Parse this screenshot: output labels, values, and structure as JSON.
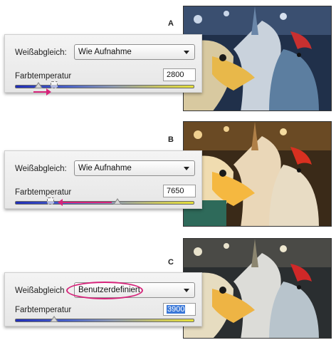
{
  "panels": [
    {
      "letter": "A",
      "wb_label": "Weißabgleich:",
      "wb_value": "Wie Aufnahme",
      "temp_label": "Farbtemperatur",
      "temp_value": "2800",
      "slider_level": 0.13,
      "ghost_level": 0.22,
      "arrow_direction": "right",
      "tint": "blue"
    },
    {
      "letter": "B",
      "wb_label": "Weißabgleich:",
      "wb_value": "Wie Aufnahme",
      "temp_label": "Farbtemperatur",
      "temp_value": "7650",
      "slider_level": 0.57,
      "ghost_level": 0.2,
      "arrow_direction": "left",
      "tint": "warm"
    },
    {
      "letter": "C",
      "wb_label": "Weißabgleich",
      "wb_value": "Benutzerdefiniert",
      "temp_label": "Farbtemperatur",
      "temp_value": "3900",
      "slider_level": 0.22,
      "temp_selected": true,
      "tint": "neutral"
    }
  ],
  "colors": {
    "annotation": "#d6247a",
    "selection": "#3b78d8"
  }
}
